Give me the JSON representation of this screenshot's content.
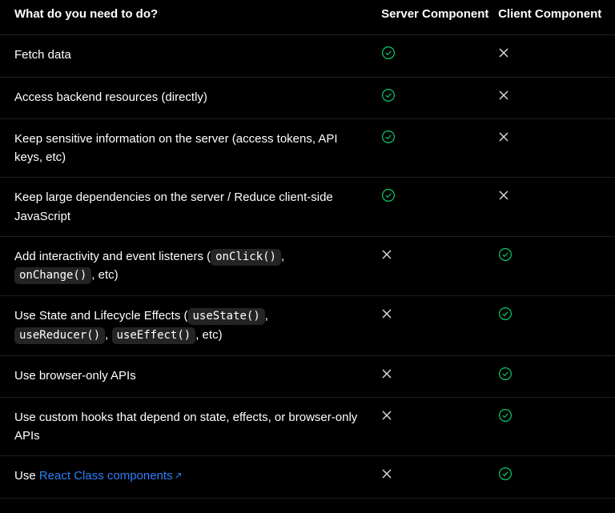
{
  "headers": {
    "task": "What do you need to do?",
    "server": "Server Component",
    "client": "Client Component"
  },
  "rows": [
    {
      "parts": [
        {
          "text": "Fetch data"
        }
      ],
      "server": "yes",
      "client": "no"
    },
    {
      "parts": [
        {
          "text": "Access backend resources (directly)"
        }
      ],
      "server": "yes",
      "client": "no"
    },
    {
      "parts": [
        {
          "text": "Keep sensitive information on the server (access tokens, API keys, etc)"
        }
      ],
      "server": "yes",
      "client": "no"
    },
    {
      "parts": [
        {
          "text": "Keep large dependencies on the server / Reduce client-side JavaScript"
        }
      ],
      "server": "yes",
      "client": "no"
    },
    {
      "parts": [
        {
          "text": "Add interactivity and event listeners ("
        },
        {
          "code": "onClick()"
        },
        {
          "text": ", "
        },
        {
          "code": "onChange()"
        },
        {
          "text": ", etc)"
        }
      ],
      "server": "no",
      "client": "yes"
    },
    {
      "parts": [
        {
          "text": "Use State and Lifecycle Effects ("
        },
        {
          "code": "useState()"
        },
        {
          "text": ", "
        },
        {
          "code": "useReducer()"
        },
        {
          "text": ", "
        },
        {
          "code": "useEffect()"
        },
        {
          "text": ", etc)"
        }
      ],
      "server": "no",
      "client": "yes"
    },
    {
      "parts": [
        {
          "text": "Use browser-only APIs"
        }
      ],
      "server": "no",
      "client": "yes"
    },
    {
      "parts": [
        {
          "text": "Use custom hooks that depend on state, effects, or browser-only APIs"
        }
      ],
      "server": "no",
      "client": "yes"
    },
    {
      "parts": [
        {
          "text": "Use "
        },
        {
          "link": "React Class components"
        }
      ],
      "server": "no",
      "client": "yes"
    }
  ]
}
